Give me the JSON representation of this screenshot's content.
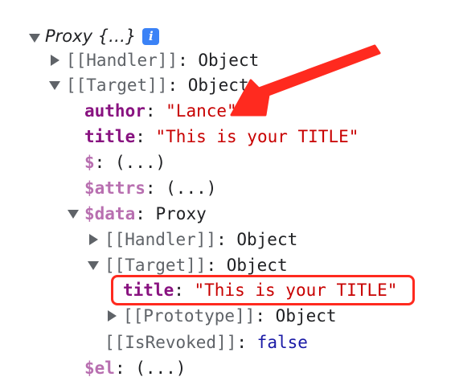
{
  "root": {
    "label": "Proxy {…}",
    "info_icon": "i"
  },
  "rows": {
    "handler1": {
      "key": "[[Handler]]",
      "value": "Object"
    },
    "target1": {
      "key": "[[Target]]",
      "value": "Object"
    },
    "author": {
      "key": "author",
      "value": "\"Lance\""
    },
    "title1": {
      "key": "title",
      "value": "\"This is your TITLE\""
    },
    "dollar": {
      "key": "$",
      "value": "(...)"
    },
    "attrs": {
      "key": "$attrs",
      "value": "(...)"
    },
    "data": {
      "key": "$data",
      "value": "Proxy"
    },
    "handler2": {
      "key": "[[Handler]]",
      "value": "Object"
    },
    "target2": {
      "key": "[[Target]]",
      "value": "Object"
    },
    "title2": {
      "key": "title",
      "value": "\"This is your TITLE\""
    },
    "prototype": {
      "key": "[[Prototype]]",
      "value": "Object"
    },
    "revoked": {
      "key": "[[IsRevoked]]",
      "value": "false"
    },
    "el": {
      "key": "$el",
      "value": "(...)"
    }
  },
  "sep": ": ",
  "colors": {
    "annotation": "#ff2a1f",
    "key": "#881280",
    "string": "#c80000",
    "boolean": "#1a1aa6"
  }
}
